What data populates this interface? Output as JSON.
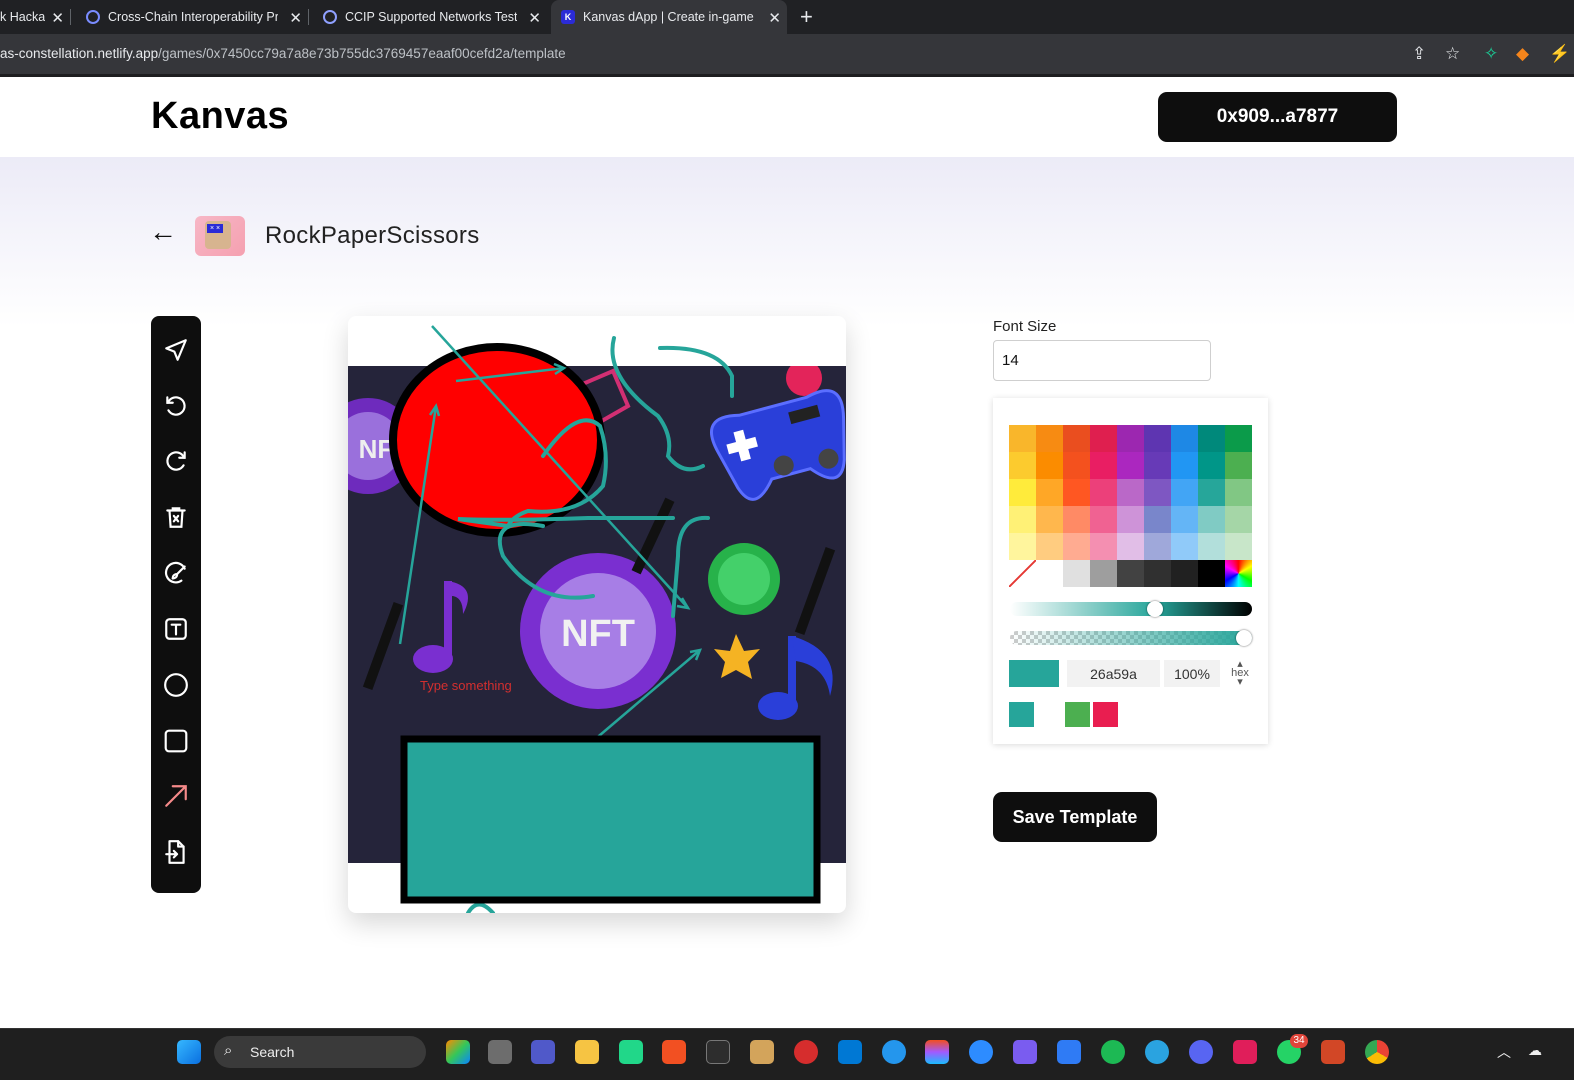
{
  "browser": {
    "tabs": [
      {
        "title": "k Hacka",
        "favicon_color": "#202124"
      },
      {
        "title": "Cross-Chain Interoperability Pro",
        "favicon_color": "#375bd2"
      },
      {
        "title": "CCIP Supported Networks Testn",
        "favicon_color": "#375bd2"
      },
      {
        "title": "Kanvas dApp | Create in-game D",
        "favicon_color": "#2b2bd6",
        "active": true
      }
    ],
    "new_tab": "+",
    "close_glyph": "✕",
    "url_host": "as-constellation.netlify.app",
    "url_path": "/games/0x7450cc79a7a8e73b755dc3769457eaaf00cefd2a/template"
  },
  "app": {
    "logo": "Kanvas",
    "wallet": "0x909...a7877"
  },
  "game": {
    "back_glyph": "←",
    "name": "RockPaperScissors"
  },
  "toolbar": {
    "tools": [
      "select-icon",
      "undo-icon",
      "redo-icon",
      "delete-icon",
      "brush-icon",
      "text-icon",
      "circle-icon",
      "rectangle-icon",
      "arrow-icon",
      "import-icon"
    ]
  },
  "canvas": {
    "placeholder_text": "Type something",
    "badge_text": "NFT",
    "badge_small": "NF",
    "colors": {
      "red": "#ff0000",
      "teal": "#26a59a",
      "background": "#25243a"
    }
  },
  "panel": {
    "font_size_label": "Font Size",
    "font_size_value": "14",
    "palette": [
      [
        "#f9b62b",
        "#f78b12",
        "#ea4e1f",
        "#df1f4f",
        "#9c27b0",
        "#5e35b1",
        "#1e88e5",
        "#00897b",
        "#0b9b4a"
      ],
      [
        "#fccb2e",
        "#fb8c00",
        "#f4511e",
        "#e91e63",
        "#ab27bf",
        "#673ab7",
        "#2196f3",
        "#009688",
        "#4caf50"
      ],
      [
        "#ffeb3b",
        "#ffa726",
        "#ff5722",
        "#ec407a",
        "#ba68c8",
        "#7e57c2",
        "#42a5f5",
        "#26a69a",
        "#81c784"
      ],
      [
        "#fff176",
        "#ffb74d",
        "#ff8a65",
        "#f06292",
        "#ce93d8",
        "#7986cb",
        "#64b5f6",
        "#80cbc4",
        "#a5d6a7"
      ],
      [
        "#fff59d",
        "#ffcc80",
        "#ffab91",
        "#f48fb1",
        "#e1bee7",
        "#9fa8da",
        "#90caf9",
        "#b2dfdb",
        "#c8e6c9"
      ],
      [
        "transparent",
        "#ffffff",
        "#e0e0e0",
        "#9e9e9e",
        "#424242",
        "#303030",
        "#212121",
        "#000000",
        "spectrum"
      ]
    ],
    "hex_value": "26a59a",
    "alpha_value": "100%",
    "mode_label": "hex",
    "hue_position": 0.6,
    "alpha_position": 1.0,
    "current_color": "#26a59a",
    "recent_colors": [
      "#26a59a",
      "#ffffff",
      "#4caf50",
      "#e91e50"
    ],
    "save_label": "Save Template"
  },
  "taskbar": {
    "search_label": "Search",
    "notification_badge": "34"
  }
}
